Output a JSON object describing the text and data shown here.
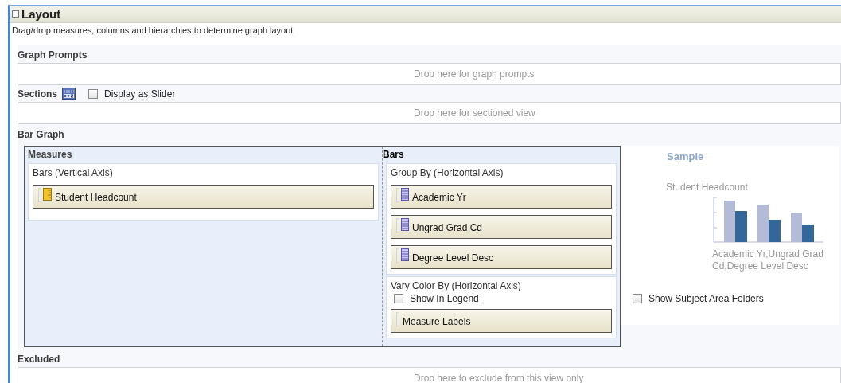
{
  "panel": {
    "title": "Layout",
    "expanded": true
  },
  "description": "Drag/drop measures, columns and hierarchies to determine graph layout",
  "graph_prompts": {
    "label": "Graph Prompts",
    "drop_hint": "Drop here for graph prompts"
  },
  "sections": {
    "label": "Sections",
    "display_as_slider": {
      "label": "Display as Slider",
      "checked": false
    },
    "drop_hint": "Drop here for sectioned view"
  },
  "bar_graph": {
    "label": "Bar Graph",
    "measures": {
      "title": "Measures",
      "groups": [
        {
          "label": "Bars (Vertical Axis)",
          "items": [
            {
              "label": "Student Headcount",
              "kind": "measure"
            }
          ]
        }
      ]
    },
    "bars": {
      "title": "Bars",
      "groups": [
        {
          "label": "Group By (Horizontal Axis)",
          "items": [
            {
              "label": "Academic Yr",
              "kind": "column"
            },
            {
              "label": "Ungrad Grad Cd",
              "kind": "column"
            },
            {
              "label": "Degree Level Desc",
              "kind": "column"
            }
          ]
        },
        {
          "label": "Vary Color By (Horizontal Axis)",
          "show_in_legend": {
            "label": "Show In Legend",
            "checked": false
          },
          "items": [
            {
              "label": "Measure Labels",
              "kind": "label"
            }
          ]
        }
      ]
    }
  },
  "sample": {
    "title": "Sample",
    "y_label": "Student Headcount",
    "x_label": "Academic Yr,Ungrad Grad Cd,Degree Level Desc"
  },
  "show_subject_area_folders": {
    "label": "Show Subject Area Folders",
    "checked": false
  },
  "excluded": {
    "label": "Excluded",
    "drop_hint": "Drop here to exclude from this view only"
  }
}
